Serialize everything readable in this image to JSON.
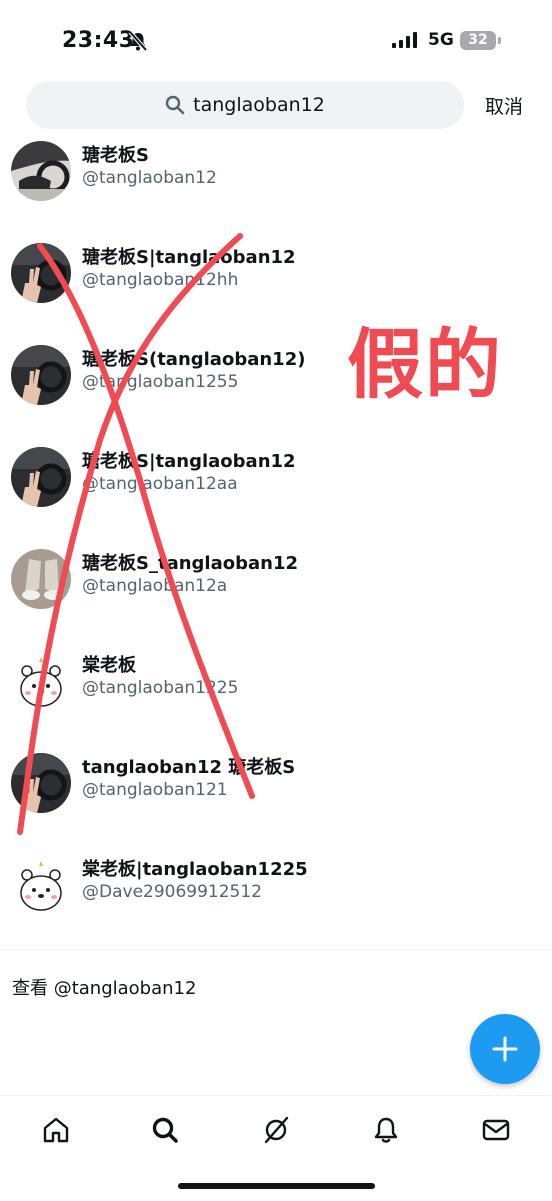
{
  "status": {
    "time": "23:43",
    "network": "5G",
    "battery": "32"
  },
  "search": {
    "query": "tanglaoban12",
    "cancel_label": "取消"
  },
  "results": [
    {
      "name": "瑭老板S",
      "handle": "@tanglaoban12",
      "avatar": "car-hand"
    },
    {
      "name": "瑭老板S|tanglaoban12",
      "handle": "@tanglaoban12hh",
      "avatar": "car-peace"
    },
    {
      "name": "瑭老板S(tanglaoban12)",
      "handle": "@tanglaoban1255",
      "avatar": "car-peace"
    },
    {
      "name": "瑭老板S|tanglaoban12",
      "handle": "@tanglaoban12aa",
      "avatar": "car-peace"
    },
    {
      "name": "瑭老板S_tanglaoban12",
      "handle": "@tanglaoban12a",
      "avatar": "shoes"
    },
    {
      "name": "棠老板",
      "handle": "@tanglaoban1225",
      "avatar": "bear"
    },
    {
      "name": "tanglaoban12 瑭老板S",
      "handle": "@tanglaoban121",
      "avatar": "car-peace"
    },
    {
      "name": "棠老板|tanglaoban1225",
      "handle": "@Dave29069912512",
      "avatar": "bear"
    }
  ],
  "view_link": "查看 @tanglaoban12",
  "annotation": {
    "text": "假的",
    "color": "#f04a52"
  },
  "colors": {
    "accent": "#1d9bf0",
    "handle_gray": "#536471",
    "search_bg": "#eff3f4"
  },
  "nav": [
    "home-icon",
    "search-icon",
    "grok-icon",
    "notifications-icon",
    "messages-icon"
  ]
}
